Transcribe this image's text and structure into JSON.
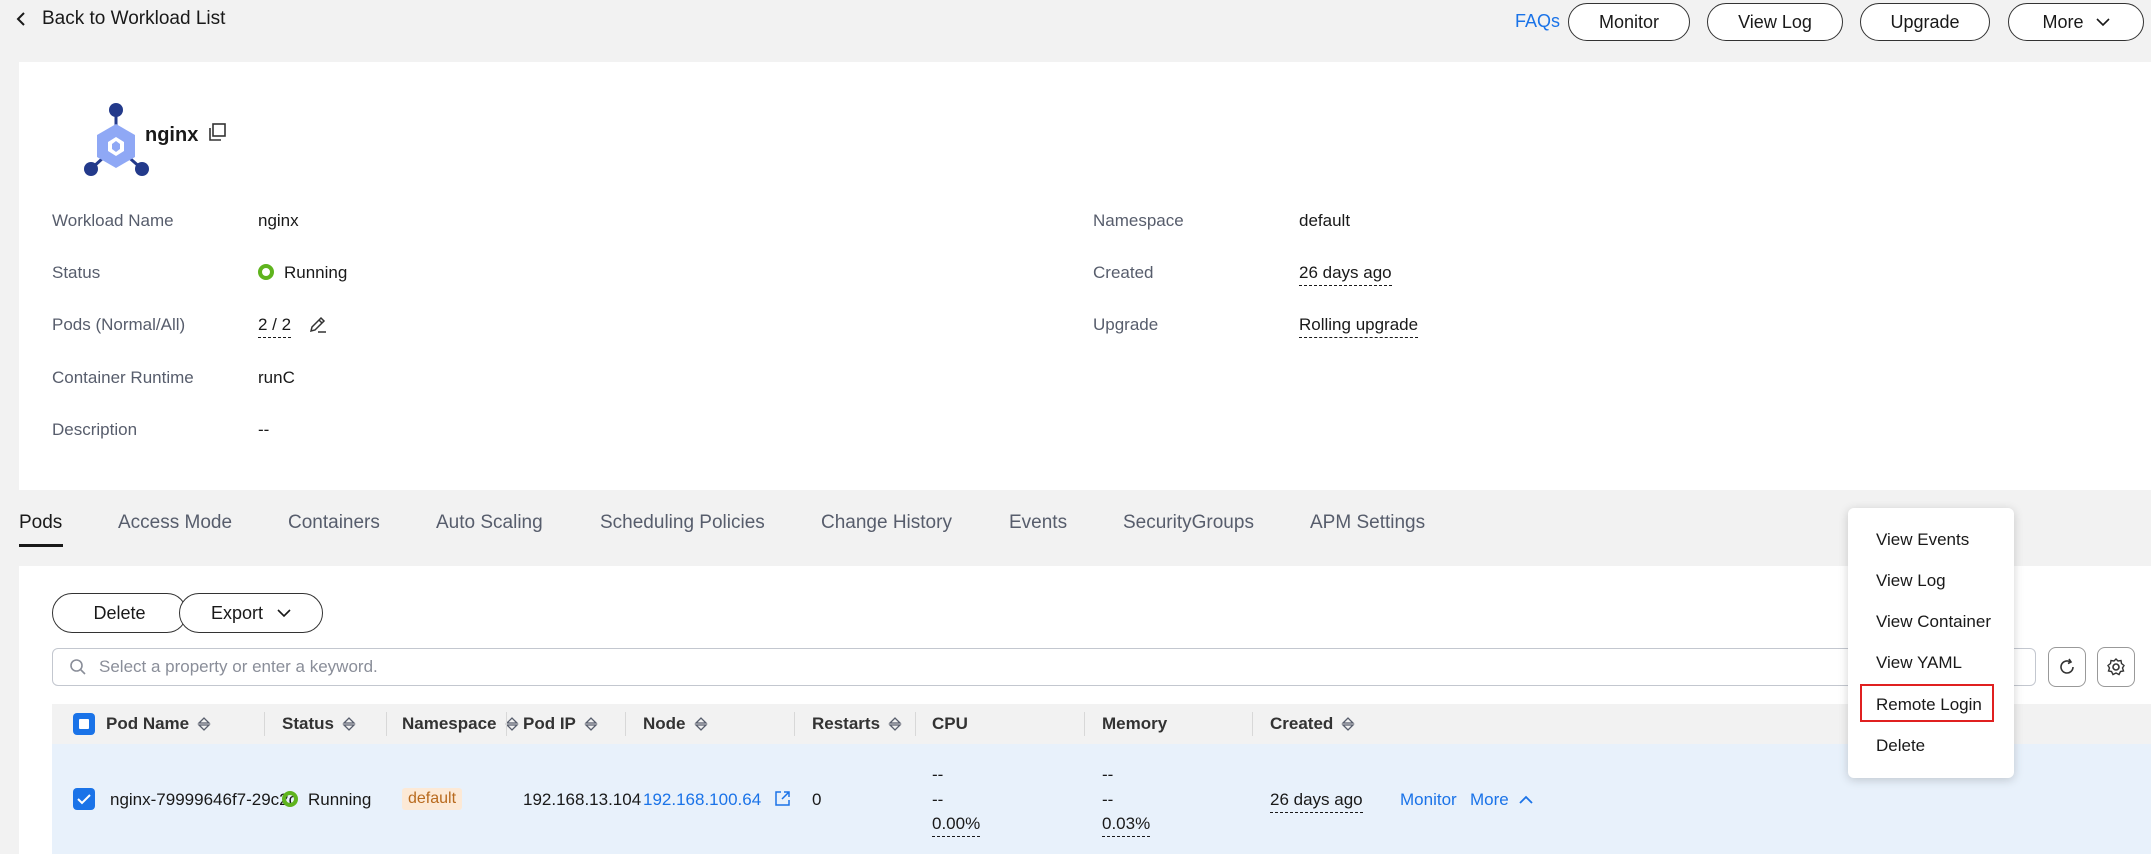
{
  "header": {
    "back_label": "Back to Workload List",
    "faqs_label": "FAQs",
    "monitor_label": "Monitor",
    "view_log_label": "View Log",
    "upgrade_label": "Upgrade",
    "more_label": "More"
  },
  "workload": {
    "name": "nginx",
    "props_left": [
      {
        "label": "Workload Name",
        "value": "nginx"
      },
      {
        "label": "Status",
        "value": "Running"
      },
      {
        "label": "Pods (Normal/All)",
        "value": "2 / 2"
      },
      {
        "label": "Container Runtime",
        "value": "runC"
      },
      {
        "label": "Description",
        "value": "--"
      }
    ],
    "props_right": [
      {
        "label": "Namespace",
        "value": "default"
      },
      {
        "label": "Created",
        "value": "26 days ago"
      },
      {
        "label": "Upgrade",
        "value": "Rolling upgrade"
      }
    ]
  },
  "tabs": [
    {
      "label": "Pods",
      "active": true
    },
    {
      "label": "Access Mode"
    },
    {
      "label": "Containers"
    },
    {
      "label": "Auto Scaling"
    },
    {
      "label": "Scheduling Policies"
    },
    {
      "label": "Change History"
    },
    {
      "label": "Events"
    },
    {
      "label": "SecurityGroups"
    },
    {
      "label": "APM Settings"
    }
  ],
  "toolbar": {
    "delete_label": "Delete",
    "export_label": "Export",
    "search_placeholder": "Select a property or enter a keyword."
  },
  "table": {
    "columns": [
      "Pod Name",
      "Status",
      "Namespace",
      "Pod IP",
      "Node",
      "Restarts",
      "CPU",
      "Memory",
      "Created"
    ],
    "rows": [
      {
        "pod_name": "nginx-79999646f7-29c2c",
        "status": "Running",
        "namespace": "default",
        "pod_ip": "192.168.13.104",
        "node": "192.168.100.64",
        "restarts": "0",
        "cpu": [
          "--",
          "--",
          "0.00%"
        ],
        "memory": [
          "--",
          "--",
          "0.03%"
        ],
        "created": "26 days ago",
        "actions": {
          "monitor": "Monitor",
          "more": "More"
        }
      }
    ]
  },
  "more_menu": {
    "items": [
      "View Events",
      "View Log",
      "View Container",
      "View YAML",
      "Remote Login",
      "Delete"
    ],
    "highlighted": "Remote Login"
  },
  "colors": {
    "accent": "#1a73e8",
    "running": "#5fb41e",
    "highlight_border": "#e02020"
  }
}
